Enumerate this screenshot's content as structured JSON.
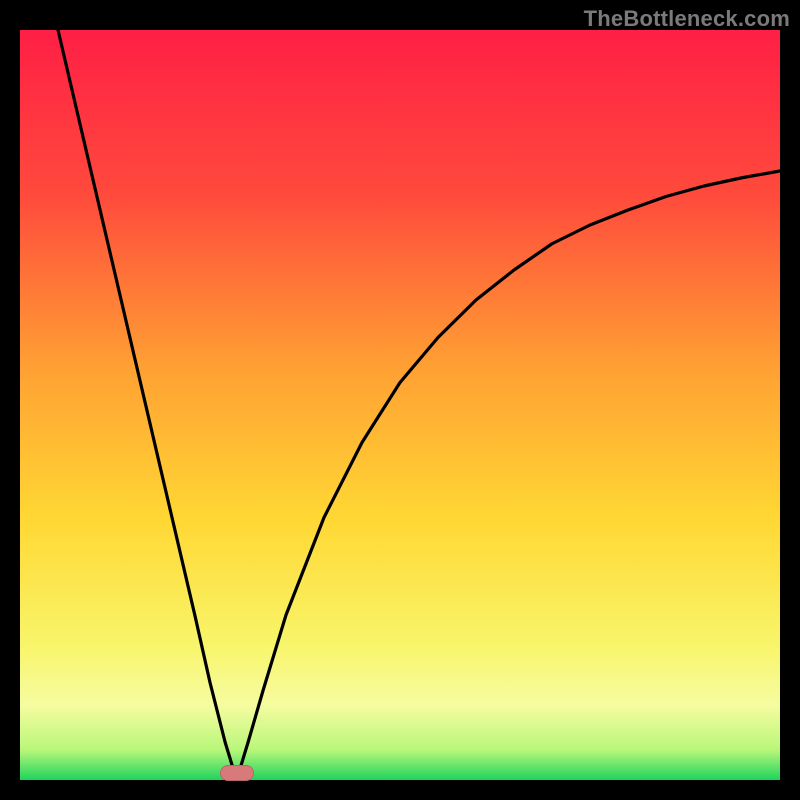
{
  "watermark": "TheBottleneck.com",
  "marker": {
    "x_percent": 28.5,
    "y_percent": 99.0,
    "color": "#d97a7a"
  },
  "chart_data": {
    "type": "line",
    "title": "",
    "xlabel": "",
    "ylabel": "",
    "xlim": [
      0,
      100
    ],
    "ylim": [
      0,
      100
    ],
    "series": [
      {
        "name": "curve",
        "x": [
          5,
          8,
          11,
          14,
          17,
          20,
          23,
          25,
          27,
          28.5,
          30,
          32,
          35,
          40,
          45,
          50,
          55,
          60,
          65,
          70,
          75,
          80,
          85,
          90,
          95,
          100
        ],
        "y": [
          100,
          87,
          74,
          61,
          48,
          35,
          22,
          13,
          5,
          0,
          5,
          12,
          22,
          35,
          45,
          53,
          59,
          64,
          68,
          71.5,
          74,
          76,
          77.8,
          79.2,
          80.3,
          81.2
        ],
        "smooth": false
      }
    ],
    "gradient_stops": [
      {
        "pos": 0.0,
        "color": "#ff1f45"
      },
      {
        "pos": 0.22,
        "color": "#ff4a3c"
      },
      {
        "pos": 0.45,
        "color": "#ffa033"
      },
      {
        "pos": 0.65,
        "color": "#ffd733"
      },
      {
        "pos": 0.82,
        "color": "#f8f56a"
      },
      {
        "pos": 0.9,
        "color": "#f6fca0"
      },
      {
        "pos": 0.96,
        "color": "#b8f77a"
      },
      {
        "pos": 1.0,
        "color": "#1fd35d"
      }
    ]
  }
}
